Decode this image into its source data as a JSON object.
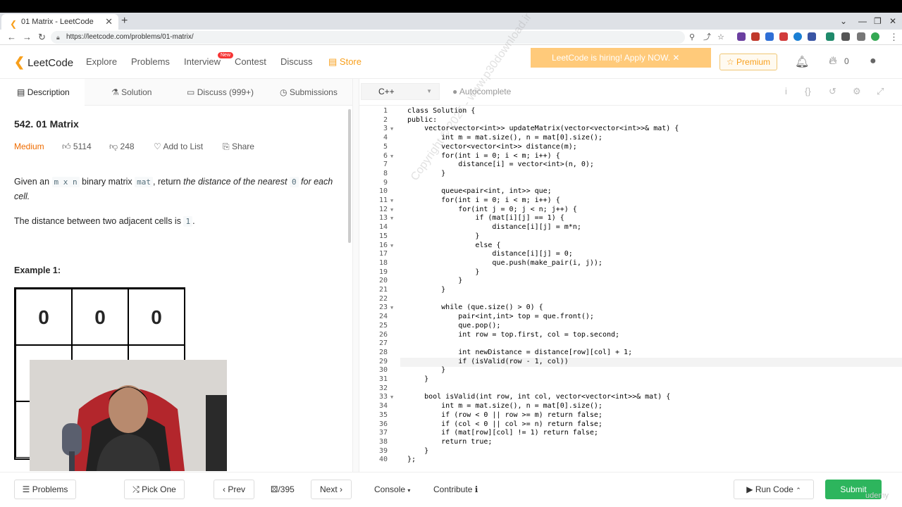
{
  "browser": {
    "tab_title": "01 Matrix - LeetCode",
    "url": "https://leetcode.com/problems/01-matrix/"
  },
  "nav": {
    "logo": "LeetCode",
    "links": [
      "Explore",
      "Problems",
      "Interview",
      "Contest",
      "Discuss",
      "Store"
    ],
    "new_badge": "New",
    "hiring": "LeetCode is hiring! Apply NOW.",
    "premium": "Premium",
    "points": "0"
  },
  "panel_tabs": [
    "Description",
    "Solution",
    "Discuss (999+)",
    "Submissions"
  ],
  "problem": {
    "title": "542. 01 Matrix",
    "difficulty": "Medium",
    "likes": "5114",
    "dislikes": "248",
    "add_to_list": "Add to List",
    "share": "Share",
    "desc_part1": "Given an",
    "desc_code1": "m x n",
    "desc_part2": "binary matrix",
    "desc_code2": "mat",
    "desc_part3": ", return",
    "desc_em": "the distance of the nearest",
    "desc_code3": "0",
    "desc_em2": "for each cell.",
    "desc2": "The distance between two adjacent cells is",
    "desc2_code": "1",
    "desc2_end": ".",
    "example_title": "Example 1:",
    "grid_values": [
      "0",
      "0",
      "0"
    ]
  },
  "editor": {
    "language": "C++",
    "autocomplete": "Autocomplete",
    "lines": [
      "class Solution {",
      "public:",
      "    vector<vector<int>> updateMatrix(vector<vector<int>>& mat) {",
      "        int m = mat.size(), n = mat[0].size();",
      "        vector<vector<int>> distance(m);",
      "        for(int i = 0; i < m; i++) {",
      "            distance[i] = vector<int>(n, 0);",
      "        }",
      "",
      "        queue<pair<int, int>> que;",
      "        for(int i = 0; i < m; i++) {",
      "            for(int j = 0; j < n; j++) {",
      "                if (mat[i][j] == 1) {",
      "                    distance[i][j] = m*n;",
      "                }",
      "                else {",
      "                    distance[i][j] = 0;",
      "                    que.push(make_pair(i, j));",
      "                }",
      "            }",
      "        }",
      "",
      "        while (que.size() > 0) {",
      "            pair<int,int> top = que.front();",
      "            que.pop();",
      "            int row = top.first, col = top.second;",
      "",
      "            int newDistance = distance[row][col] + 1;",
      "            if (isValid(row - 1, col))",
      "        }",
      "    }",
      "",
      "    bool isValid(int row, int col, vector<vector<int>>& mat) {",
      "        int m = mat.size(), n = mat[0].size();",
      "        if (row < 0 || row >= m) return false;",
      "        if (col < 0 || col >= n) return false;",
      "        if (mat[row][col] != 1) return false;",
      "        return true;",
      "    }",
      "};"
    ],
    "fold_lines": [
      3,
      6,
      11,
      12,
      13,
      16,
      23,
      33
    ],
    "current_line": 29
  },
  "watermark": "Copyright © 2025 - www.p30download.ir",
  "bottom": {
    "problems": "Problems",
    "pick_one": "Pick One",
    "prev": "Prev",
    "page": "/395",
    "next": "Next",
    "console": "Console",
    "contribute": "Contribute",
    "run_code": "Run Code",
    "submit": "Submit"
  },
  "overlay_brand": "udemy",
  "colors": {
    "accent": "#f89f1b",
    "submit": "#2db55d",
    "difficulty_medium": "#ef6c00"
  }
}
